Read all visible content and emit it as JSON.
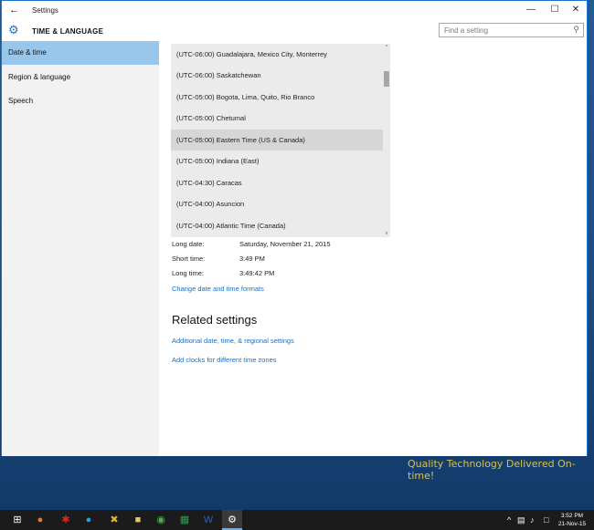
{
  "window": {
    "title": "Settings",
    "back_glyph": "←",
    "minimize_glyph": "—",
    "maximize_glyph": "☐",
    "close_glyph": "✕"
  },
  "header": {
    "section": "TIME & LANGUAGE",
    "gear_glyph": "⚙",
    "search_placeholder": "Find a setting",
    "search_glyph": "⚲"
  },
  "sidebar": {
    "items": [
      {
        "label": "Date & time",
        "active": true
      },
      {
        "label": "Region & language",
        "active": false
      },
      {
        "label": "Speech",
        "active": false
      }
    ]
  },
  "timezone_list": {
    "items": [
      "(UTC-06:00) Guadalajara, Mexico City, Monterrey",
      "(UTC-06:00) Saskatchewan",
      "(UTC-05:00) Bogota, Lima, Quito, Rio Branco",
      "(UTC-05:00) Chetumal",
      "(UTC-05:00) Eastern Time (US & Canada)",
      "(UTC-05:00) Indiana (East)",
      "(UTC-04:30) Caracas",
      "(UTC-04:00) Asuncion",
      "(UTC-04:00) Atlantic Time (Canada)"
    ],
    "selected_index": 4,
    "scroll_up_glyph": "^",
    "scroll_down_glyph": "v"
  },
  "formats": {
    "long_date_label": "Long date:",
    "long_date_value": "Saturday, November 21, 2015",
    "short_time_label": "Short time:",
    "short_time_value": "3:49 PM",
    "long_time_label": "Long time:",
    "long_time_value": "3:49:42 PM",
    "change_link": "Change date and time formats"
  },
  "related": {
    "title": "Related settings",
    "link1": "Additional date, time, & regional settings",
    "link2": "Add clocks for different time zones"
  },
  "desktop": {
    "wallpaper_text": "Quality Technology Delivered On-time!"
  },
  "taskbar": {
    "clock_time": "3:52 PM",
    "clock_date": "21-Nov-15",
    "colors": {
      "accent": "#1a73c9",
      "link": "#1a6fc0",
      "selected_nav": "#99c7ec"
    }
  }
}
